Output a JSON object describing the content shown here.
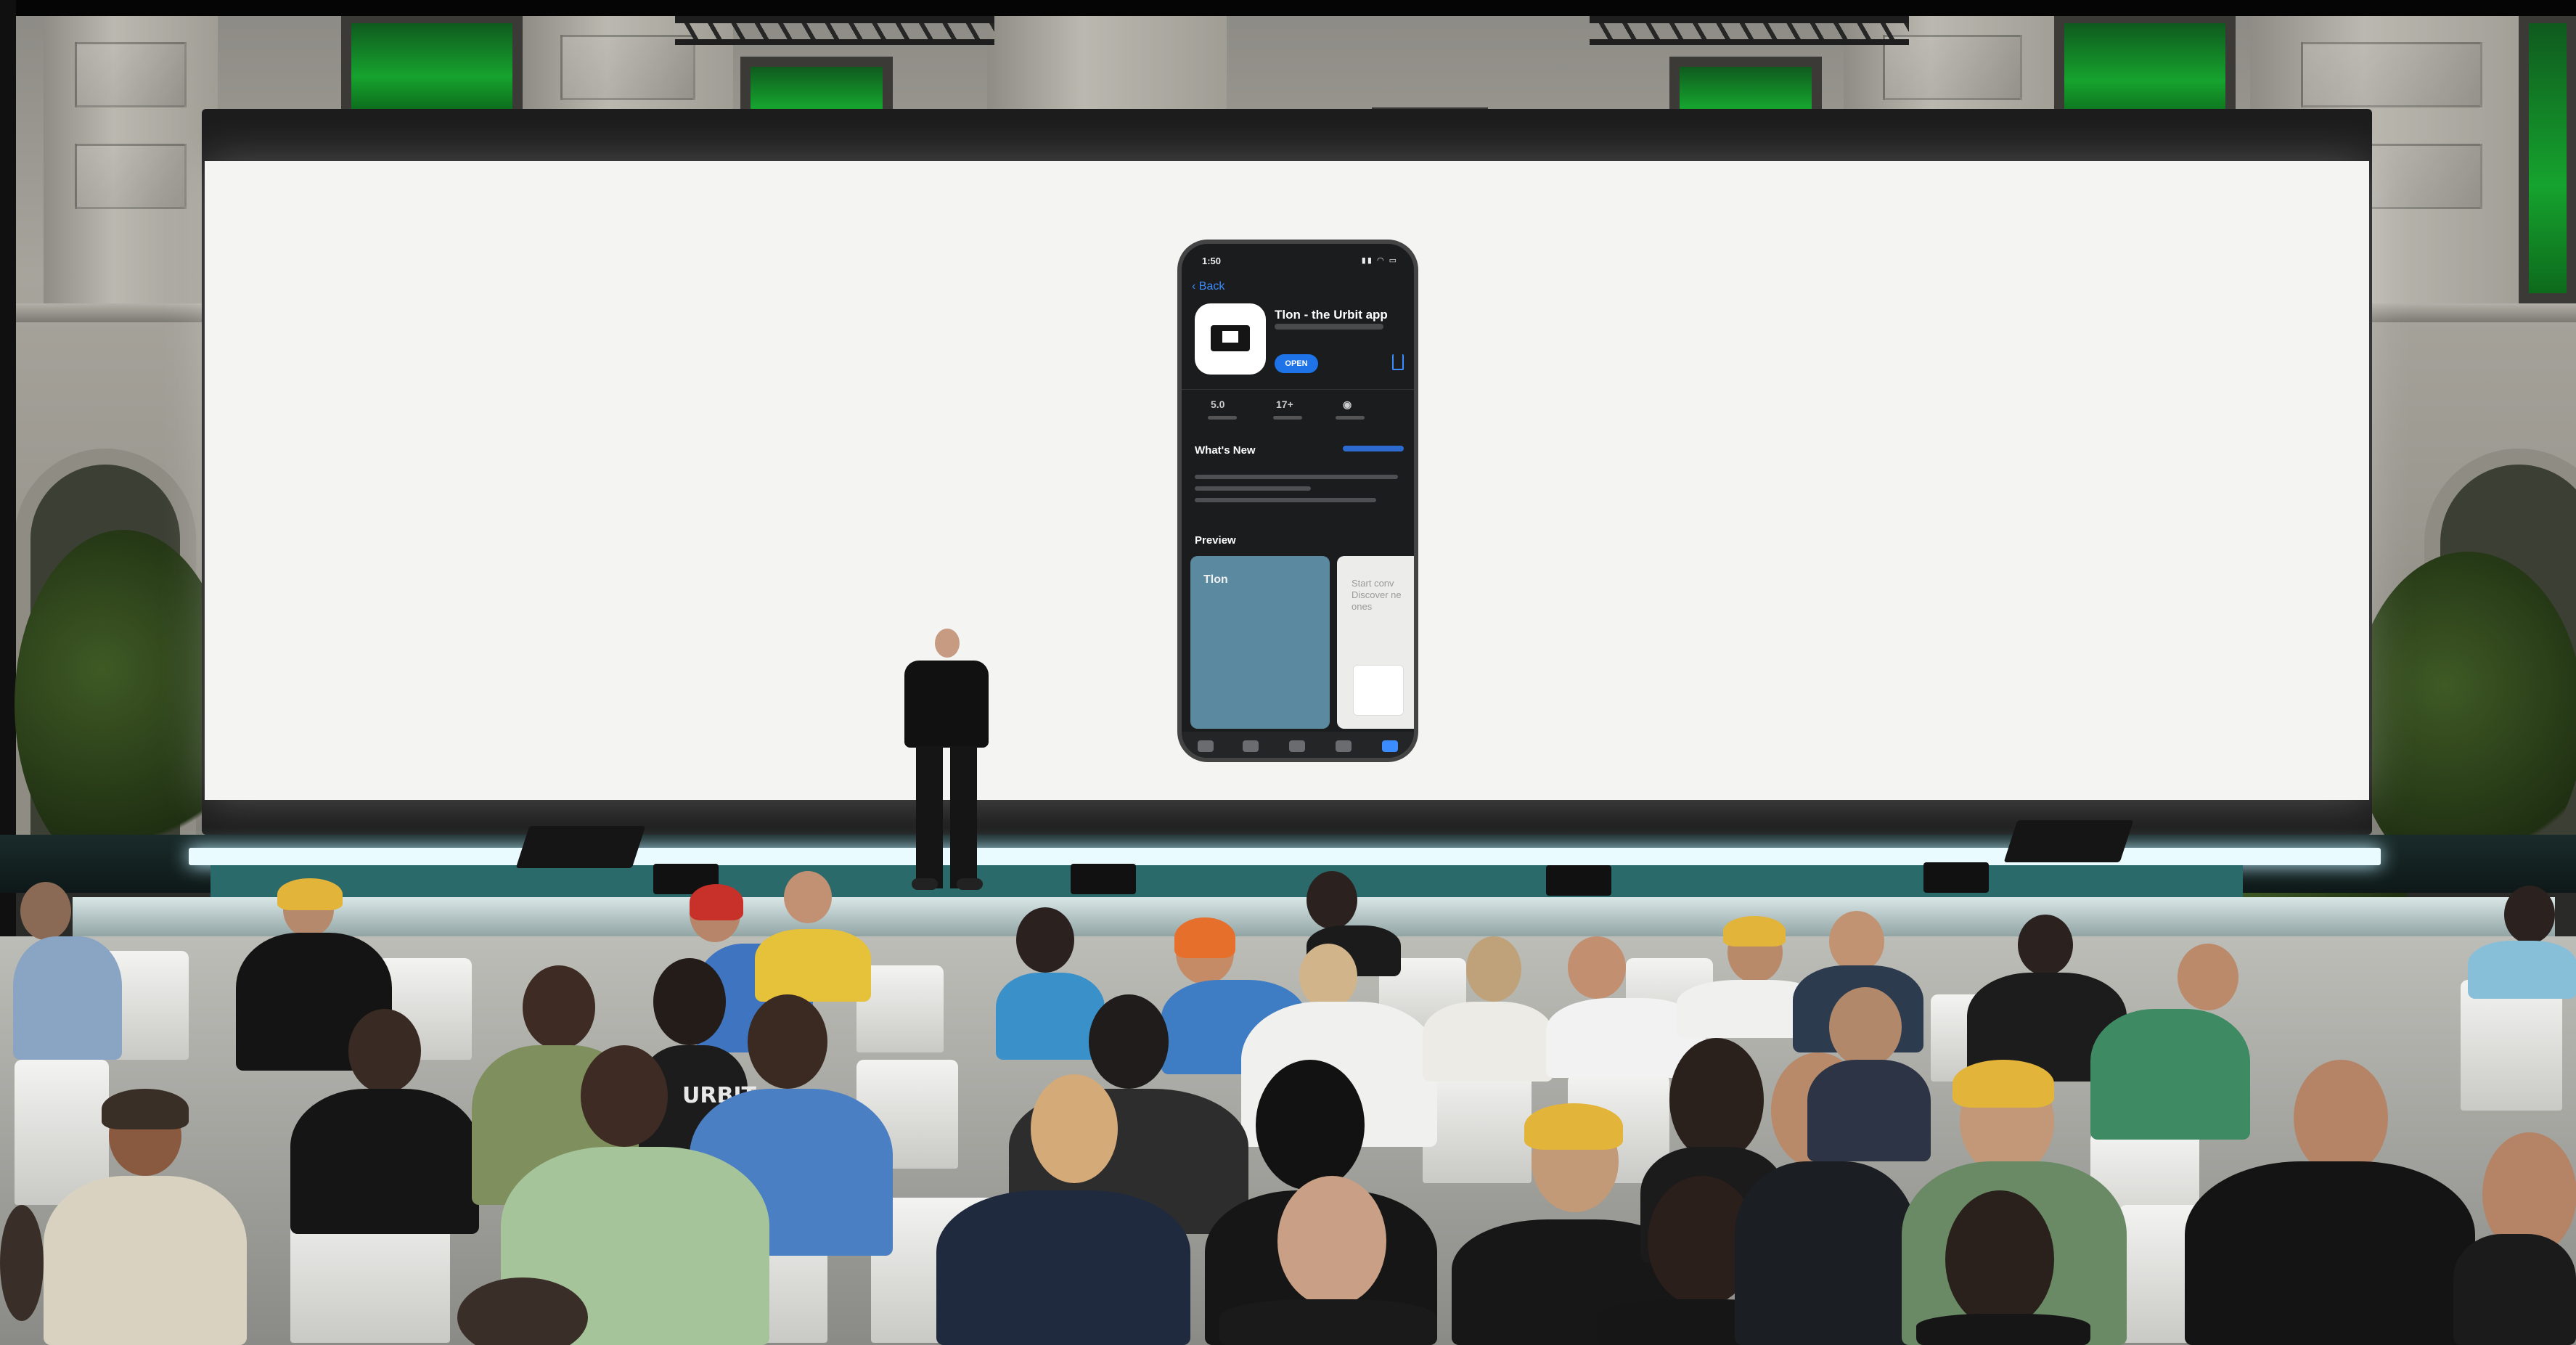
{
  "scene": {
    "description_free": true,
    "colors": {
      "screen": "#f4f4f3",
      "app_background": "#1b1c1e",
      "accent_blue": "#1e73e8",
      "stage_teal": "#2b6a6a",
      "window_green": "#16a32e"
    }
  },
  "phone": {
    "status_time": "1:50",
    "back_label": "Back",
    "app_title": "Tlon - the Urbit app",
    "open_button": "OPEN",
    "stats": [
      {
        "value": "5.0",
        "icon": "stars"
      },
      {
        "value": "17+",
        "icon": ""
      },
      {
        "value": "",
        "icon": "developer-icon"
      }
    ],
    "whats_new_heading": "What's New",
    "preview_heading": "Preview",
    "preview_1_label": "Tlon",
    "preview_2_text": "Start conv Discover ne ones"
  },
  "audience": {
    "shirt_text": "URBIT"
  }
}
